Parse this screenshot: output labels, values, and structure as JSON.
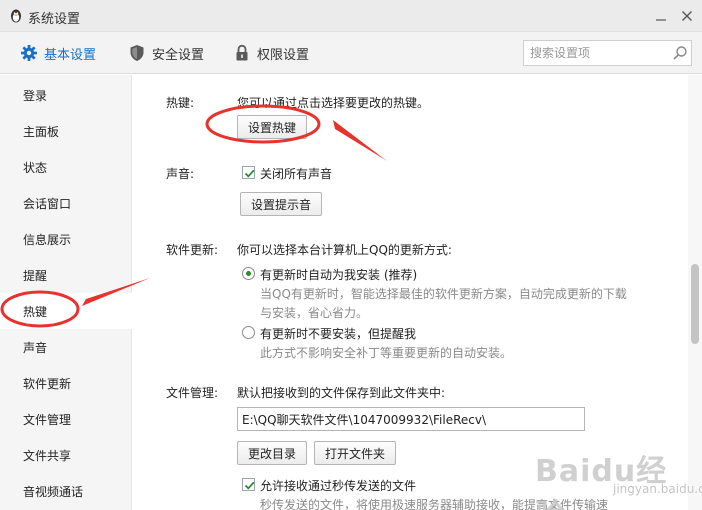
{
  "window": {
    "title": "系统设置"
  },
  "tabs": [
    {
      "label": "基本设置",
      "icon": "gear-icon",
      "active": true
    },
    {
      "label": "安全设置",
      "icon": "shield-icon"
    },
    {
      "label": "权限设置",
      "icon": "lock-icon"
    }
  ],
  "search": {
    "placeholder": "搜索设置项"
  },
  "sidebar": {
    "items": [
      {
        "label": "登录"
      },
      {
        "label": "主面板"
      },
      {
        "label": "状态"
      },
      {
        "label": "会话窗口"
      },
      {
        "label": "信息展示"
      },
      {
        "label": "提醒"
      },
      {
        "label": "热键",
        "active": true
      },
      {
        "label": "声音"
      },
      {
        "label": "软件更新"
      },
      {
        "label": "文件管理"
      },
      {
        "label": "文件共享"
      },
      {
        "label": "音视频通话"
      }
    ]
  },
  "hotkey": {
    "label": "热键:",
    "description": "您可以通过点击选择要更改的热键。",
    "button": "设置热键"
  },
  "sound": {
    "label": "声音:",
    "mute_all": "关闭所有声音",
    "mute_all_checked": true,
    "button": "设置提示音"
  },
  "update": {
    "label": "软件更新:",
    "description": "你可以选择本台计算机上QQ的更新方式:",
    "option_auto": "有更新时自动为我安装 (推荐)",
    "option_auto_note_1": "当QQ有更新时，智能选择最佳的软件更新方案，自动完成更新的下载",
    "option_auto_note_2": "与安装，省心省力。",
    "option_notify": "有更新时不要安装，但提醒我",
    "option_notify_note": "此方式不影响安全补丁等重要更新的自动安装。",
    "selected": "auto"
  },
  "file_manage": {
    "label": "文件管理:",
    "description": "默认把接收到的文件保存到此文件夹中:",
    "path": "E:\\QQ聊天软件文件\\1047009932\\FileRecv\\",
    "change_dir_button": "更改目录",
    "open_folder_button": "打开文件夹",
    "allow_instant": "允许接收通过秒传发送的文件",
    "allow_instant_checked": true,
    "instant_note": "秒传发送的文件，将使用极速服务器辅助接收，能提高文件传输速"
  },
  "watermark": {
    "brand": "Baidu经验",
    "url": "jingyan.baidu.com"
  },
  "colors": {
    "accent": "#1a6fc6",
    "annotation_red": "#e8322e",
    "check_green": "#2a8c2a"
  }
}
